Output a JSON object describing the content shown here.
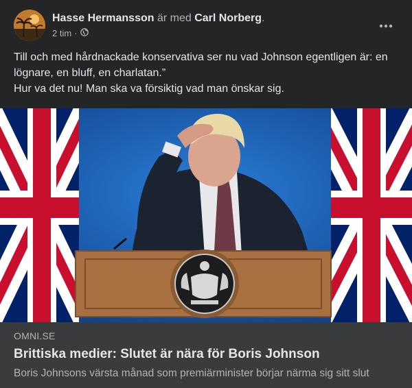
{
  "post": {
    "author": "Hasse Hermansson",
    "with_word": " är med ",
    "tagged": "Carl Norberg",
    "tagged_suffix": ".",
    "time": "2 tim",
    "separator": "·",
    "privacy_icon": "globe-icon",
    "more_icon": "more-options-icon",
    "text_line1": "Till och med hårdnackade konservativa ser nu vad Johnson egentligen är: en lögnare, en bluff, en charlatan.”",
    "text_line2": "Hur va det nu! Man ska va försiktig vad man önskar sig."
  },
  "link": {
    "domain": "OMNI.SE",
    "title": "Brittiska medier: Slutet är nära för Boris Johnson",
    "description": "Boris Johnsons värsta månad som premiärminister börjar närma sig sitt slut"
  },
  "colors": {
    "card_bg": "#242526",
    "link_bg": "#3a3b3c",
    "text_primary": "#e4e6eb",
    "text_secondary": "#b0b3b8",
    "backdrop_blue": "#1f64b9",
    "flag_red": "#c8102e",
    "flag_blue": "#012169",
    "podium_wood": "#a97142"
  }
}
